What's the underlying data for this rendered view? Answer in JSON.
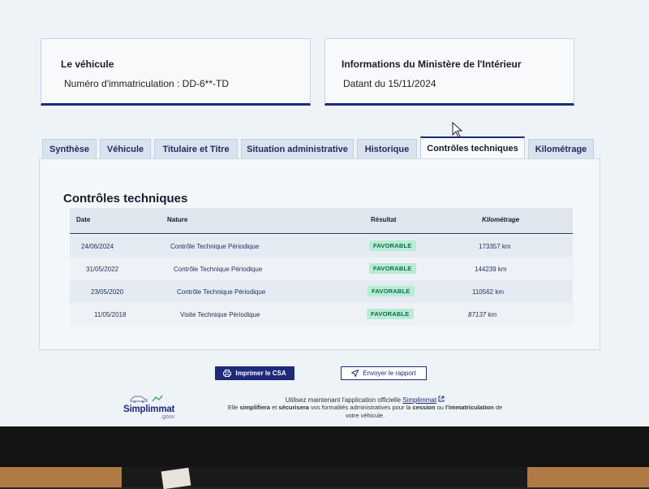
{
  "vehicle_card": {
    "title": "Le véhicule",
    "plate_line": "Numéro d'immatriculation : DD-6**-TD"
  },
  "ministry_card": {
    "title": "Informations du Ministère de l'Intérieur",
    "date_line": "Datant du 15/11/2024"
  },
  "tabs": [
    {
      "label": "Synthèse"
    },
    {
      "label": "Véhicule"
    },
    {
      "label": "Titulaire et Titre"
    },
    {
      "label": "Situation administrative"
    },
    {
      "label": "Historique"
    },
    {
      "label": "Contrôles techniques",
      "active": true
    },
    {
      "label": "Kilométrage"
    }
  ],
  "section": {
    "title": "Contrôles techniques",
    "columns": {
      "date": "Date",
      "nature": "Nature",
      "result": "Résultat",
      "mileage": "Kilométrage"
    },
    "rows": [
      {
        "date": "24/06/2024",
        "nature": "Contrôle Technique Périodique",
        "result": "FAVORABLE",
        "mileage": "173357 km"
      },
      {
        "date": "31/05/2022",
        "nature": "Contrôle Technique Périodique",
        "result": "FAVORABLE",
        "mileage": "144239 km"
      },
      {
        "date": "23/05/2020",
        "nature": "Contrôle Technique Périodique",
        "result": "FAVORABLE",
        "mileage": "110562 km"
      },
      {
        "date": "11/05/2018",
        "nature": "Visite Technique Périodique",
        "result": "FAVORABLE",
        "mileage": "87137 km"
      }
    ]
  },
  "actions": {
    "print_label": "Imprimer le CSA",
    "report_label": "Envoyer le rapport"
  },
  "footer": {
    "logo_name": "Simplimmat",
    "logo_suffix": ".gouv",
    "line1_prefix": "Utilisez maintenant l'application officielle",
    "line1_link": "Simplimmat",
    "line2_a": "Elle",
    "line2_b": "simplifiera",
    "line2_c": "et",
    "line2_d": "sécurisera",
    "line2_e": "vos formalités administratives pour la",
    "line2_f": "cession",
    "line2_g": "ou",
    "line2_h": "l'immatriculation",
    "line2_i": "de",
    "line3": "votre véhicule."
  },
  "colors": {
    "accent": "#1e2a7a",
    "badge_bg": "#b7ecd6",
    "badge_text": "#146b4a"
  }
}
